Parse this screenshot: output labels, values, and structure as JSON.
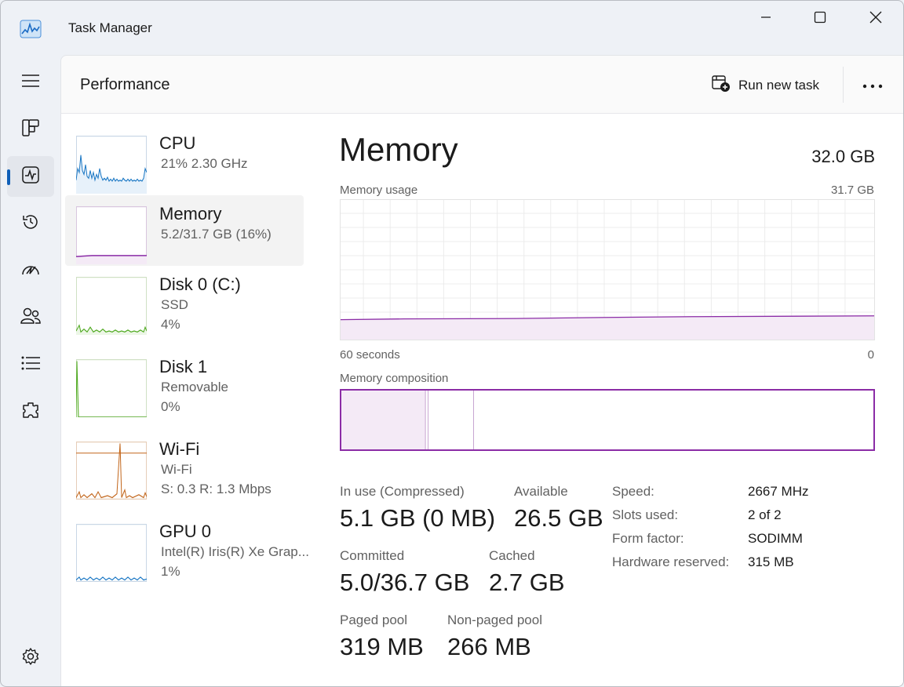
{
  "window": {
    "title": "Task Manager",
    "controls": {
      "minimize": "minimize-icon",
      "maximize": "maximize-icon",
      "close": "close-icon"
    }
  },
  "nav_rail": [
    {
      "icon": "hamburger-menu-icon"
    },
    {
      "icon": "processes-icon"
    },
    {
      "icon": "performance-icon",
      "active": true
    },
    {
      "icon": "app-history-icon"
    },
    {
      "icon": "startup-apps-icon"
    },
    {
      "icon": "users-icon"
    },
    {
      "icon": "details-icon"
    },
    {
      "icon": "services-icon"
    },
    {
      "icon": "settings-icon"
    }
  ],
  "header": {
    "page_title": "Performance",
    "run_new_task": "Run new task",
    "more_icon": "more-options-icon"
  },
  "devices": [
    {
      "name": "CPU",
      "line1": "21%  2.30 GHz",
      "line2": "",
      "color": "#1a77c4"
    },
    {
      "name": "Memory",
      "line1": "5.2/31.7 GB (16%)",
      "line2": "",
      "color": "#8b2ca6",
      "selected": true
    },
    {
      "name": "Disk 0 (C:)",
      "line1": "SSD",
      "line2": "4%",
      "color": "#4ca81c"
    },
    {
      "name": "Disk 1",
      "line1": "Removable",
      "line2": "0%",
      "color": "#4ca81c"
    },
    {
      "name": "Wi-Fi",
      "line1": "Wi-Fi",
      "line2": "S: 0.3  R: 1.3 Mbps",
      "color": "#c2651a"
    },
    {
      "name": "GPU 0",
      "line1": "Intel(R) Iris(R) Xe Grap...",
      "line2": "1%",
      "color": "#1a77c4"
    }
  ],
  "memory": {
    "title": "Memory",
    "total": "32.0 GB",
    "usage_label": "Memory usage",
    "usage_max": "31.7 GB",
    "graph_left_label": "60 seconds",
    "graph_right_label": "0",
    "usage_fraction": 0.16,
    "composition_label": "Memory composition",
    "composition": {
      "in_use_fraction": 0.16,
      "modified_fraction": 0.005,
      "standby_fraction": 0.085
    },
    "stats": {
      "in_use_label": "In use (Compressed)",
      "in_use_value": "5.1 GB (0 MB)",
      "available_label": "Available",
      "available_value": "26.5 GB",
      "committed_label": "Committed",
      "committed_value": "5.0/36.7 GB",
      "cached_label": "Cached",
      "cached_value": "2.7 GB",
      "paged_label": "Paged pool",
      "paged_value": "319 MB",
      "nonpaged_label": "Non-paged pool",
      "nonpaged_value": "266 MB"
    },
    "specs": [
      {
        "label": "Speed:",
        "value": "2667 MHz"
      },
      {
        "label": "Slots used:",
        "value": "2 of 2"
      },
      {
        "label": "Form factor:",
        "value": "SODIMM"
      },
      {
        "label": "Hardware reserved:",
        "value": "315 MB"
      }
    ]
  },
  "colors": {
    "memory_accent": "#8b2ca6",
    "memory_fill": "#f4eaf6",
    "cpu": "#1a77c4",
    "disk": "#4ca81c",
    "wifi": "#c2651a",
    "gpu": "#1a77c4",
    "active_indicator": "#0f5fb8"
  }
}
